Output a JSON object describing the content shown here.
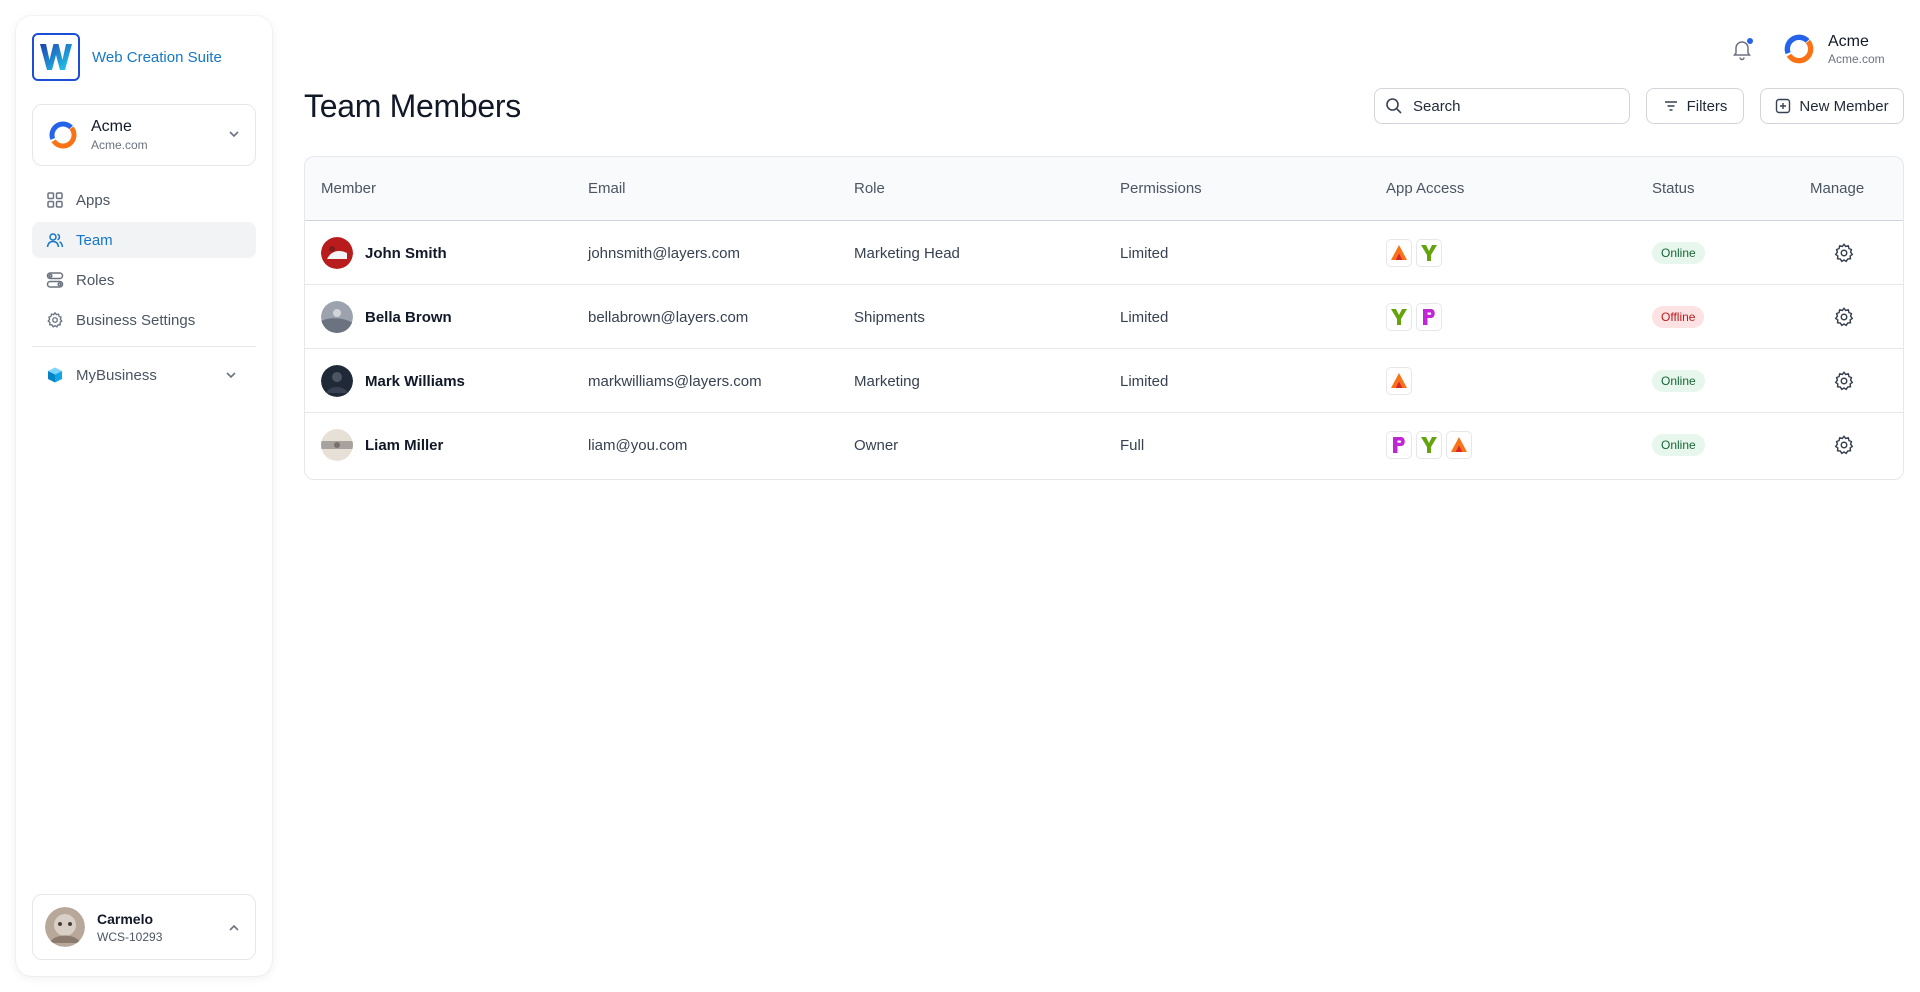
{
  "brand": {
    "name": "Web Creation Suite"
  },
  "org_switcher": {
    "name": "Acme",
    "domain": "Acme.com"
  },
  "nav": {
    "items": [
      {
        "label": "Apps",
        "icon": "apps-grid-icon"
      },
      {
        "label": "Team",
        "icon": "users-icon",
        "active": true
      },
      {
        "label": "Roles",
        "icon": "roles-toggle-icon"
      },
      {
        "label": "Business Settings",
        "icon": "gear-icon"
      }
    ],
    "business": {
      "label": "MyBusiness",
      "icon": "cube-icon"
    }
  },
  "user": {
    "name": "Carmelo",
    "id": "WCS-10293"
  },
  "header": {
    "account_name": "Acme",
    "account_domain": "Acme.com"
  },
  "page": {
    "title": "Team Members"
  },
  "toolbar": {
    "search_placeholder": "Search",
    "filters_label": "Filters",
    "new_member_label": "New Member"
  },
  "table": {
    "columns": [
      "Member",
      "Email",
      "Role",
      "Permissions",
      "App Access",
      "Status",
      "Manage"
    ],
    "rows": [
      {
        "name": "John Smith",
        "email": "johnsmith@layers.com",
        "role": "Marketing Head",
        "permissions": "Limited",
        "apps": [
          "A",
          "Y"
        ],
        "status": "Online"
      },
      {
        "name": "Bella Brown",
        "email": "bellabrown@layers.com",
        "role": "Shipments",
        "permissions": "Limited",
        "apps": [
          "Y",
          "P"
        ],
        "status": "Offline"
      },
      {
        "name": "Mark Williams",
        "email": "markwilliams@layers.com",
        "role": "Marketing",
        "permissions": "Limited",
        "apps": [
          "A"
        ],
        "status": "Online"
      },
      {
        "name": "Liam Miller",
        "email": "liam@you.com",
        "role": "Owner",
        "permissions": "Full",
        "apps": [
          "P",
          "Y",
          "A"
        ],
        "status": "Online"
      }
    ]
  },
  "colors": {
    "accent": "#1677c9",
    "online_bg": "#e8f7ee",
    "offline_bg": "#fde2e4"
  }
}
